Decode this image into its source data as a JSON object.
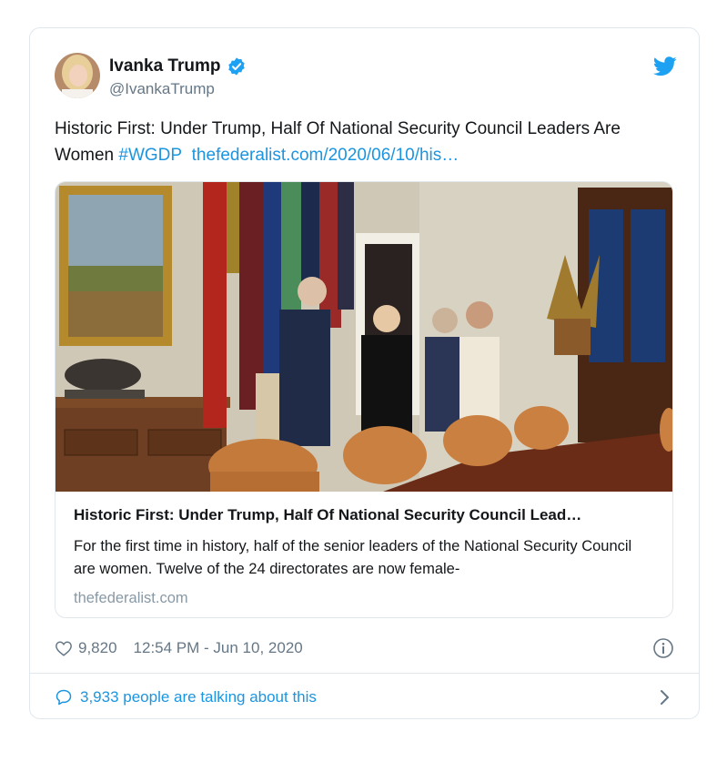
{
  "tweet": {
    "author_name": "Ivanka Trump",
    "author_handle": "@IvankaTrump",
    "text_plain": "Historic First: Under Trump, Half Of National Security Council Leaders Are Women",
    "hashtag": "#WGDP",
    "link_text": "thefederalist.com/2020/06/10/his…"
  },
  "link_card": {
    "title": "Historic First: Under Trump, Half Of National Security Council Lead…",
    "description": "For the first time in history, half of the senior leaders of the National Security Council are women. Twelve of the 24 directorates are now female-",
    "domain": "thefederalist.com"
  },
  "meta": {
    "likes": "9,820",
    "timestamp": "12:54 PM - Jun 10, 2020"
  },
  "conversation": {
    "label": "3,933 people are talking about this"
  },
  "colors": {
    "accent": "#1b95e0",
    "twitter_blue": "#1da1f2",
    "secondary_text": "#657786",
    "border": "#e1e8ed"
  },
  "icons": [
    "verified-badge-icon",
    "twitter-bird-icon",
    "heart-icon",
    "info-icon",
    "comment-bubble-icon",
    "chevron-right-icon"
  ]
}
